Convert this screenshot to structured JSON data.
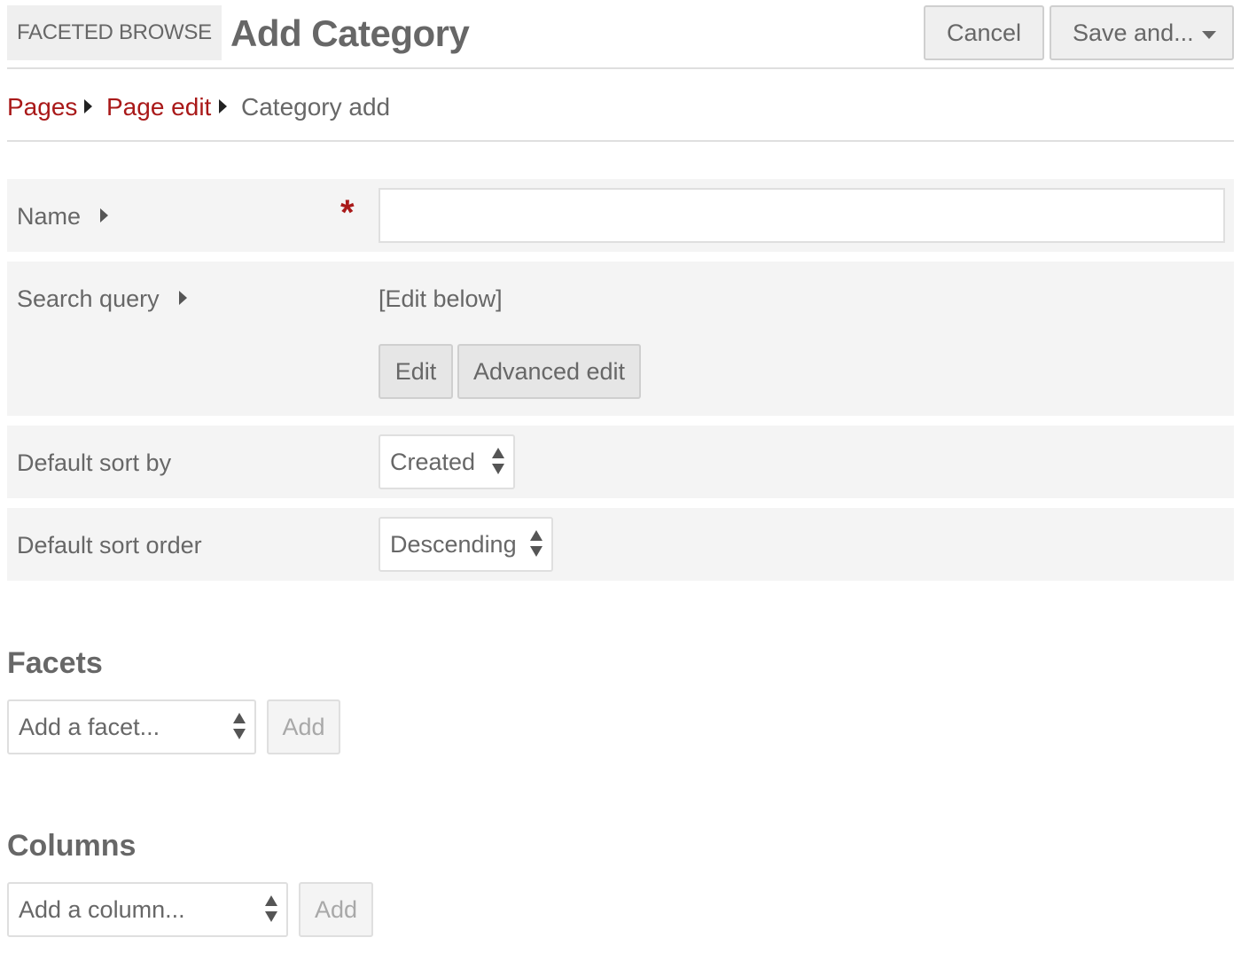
{
  "header": {
    "module_label": "FACETED BROWSE",
    "title": "Add Category",
    "cancel_label": "Cancel",
    "save_label": "Save and..."
  },
  "breadcrumb": {
    "items": [
      {
        "label": "Pages",
        "link": true
      },
      {
        "label": "Page edit",
        "link": true
      },
      {
        "label": "Category add",
        "link": false
      }
    ]
  },
  "form": {
    "name": {
      "label": "Name",
      "required_mark": "*",
      "value": ""
    },
    "search_query": {
      "label": "Search query",
      "value": "[Edit below]",
      "edit_label": "Edit",
      "advanced_edit_label": "Advanced edit"
    },
    "default_sort_by": {
      "label": "Default sort by",
      "selected": "Created"
    },
    "default_sort_order": {
      "label": "Default sort order",
      "selected": "Descending"
    }
  },
  "facets": {
    "title": "Facets",
    "select_placeholder": "Add a facet...",
    "add_label": "Add"
  },
  "columns": {
    "title": "Columns",
    "select_placeholder": "Add a column...",
    "add_label": "Add"
  },
  "colors": {
    "accent": "#a91919",
    "text": "#676767",
    "row_bg": "#f4f4f4"
  }
}
